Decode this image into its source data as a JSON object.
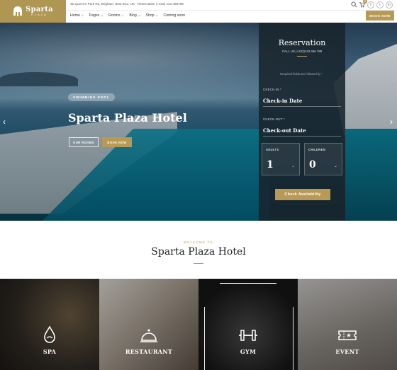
{
  "brand": {
    "name": "Sparta",
    "sub": "PLAZA"
  },
  "topbar": {
    "address": "45 Queen's Park Rd, Brighton, BN2 0GJ, UK - Reservation (+233) 123 456789",
    "cart_count": "0",
    "social": [
      "f",
      "t",
      "in"
    ]
  },
  "nav": {
    "items": [
      "Home ⌄",
      "Pages ⌄",
      "Rooms ⌄",
      "Blog ⌄",
      "Shop ⌄",
      "Coming soon"
    ],
    "book_now": "BOOK NOW"
  },
  "hero": {
    "tag": "SWIMMING POOL",
    "title": "Sparta Plaza Hotel",
    "our_rooms": "OUR ROOMS",
    "book_now": "BOOK NOW",
    "prev": "‹",
    "next": "›"
  },
  "reservation": {
    "title": "Reservation",
    "call": "CALL US (+233)123 456 789",
    "required": "Required fields are followed by *",
    "checkin_label": "CHECK-IN *",
    "checkin_value": "Check-in Date",
    "checkout_label": "CHECK-OUT *",
    "checkout_value": "Check-out Date",
    "adults_label": "ADULTS",
    "adults_value": "1",
    "children_label": "CHILDREN",
    "children_value": "0",
    "button": "Check Availability"
  },
  "welcome": {
    "small": "WELCOME TO",
    "title": "Sparta Plaza Hotel"
  },
  "features": [
    {
      "label": "SPA",
      "icon": "spa-icon"
    },
    {
      "label": "RESTAURANT",
      "icon": "cloche-icon"
    },
    {
      "label": "GYM",
      "icon": "dumbbell-icon"
    },
    {
      "label": "EVENT",
      "icon": "ticket-icon"
    }
  ],
  "colors": {
    "accent": "#b89a56",
    "panel": "#18242c"
  }
}
